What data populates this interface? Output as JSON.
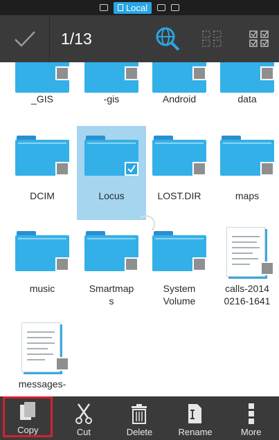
{
  "location_bar": {
    "label": "Local"
  },
  "header": {
    "selection_count": "1/13"
  },
  "grid": {
    "items": [
      {
        "name": "_GIS",
        "type": "folder",
        "selected": false
      },
      {
        "name": "-gis",
        "type": "folder",
        "selected": false
      },
      {
        "name": "Android",
        "type": "folder",
        "selected": false
      },
      {
        "name": "data",
        "type": "folder",
        "selected": false
      },
      {
        "name": "DCIM",
        "type": "folder",
        "selected": false
      },
      {
        "name": "Locus",
        "type": "folder",
        "selected": true
      },
      {
        "name": "LOST.DIR",
        "type": "folder",
        "selected": false
      },
      {
        "name": "maps",
        "type": "folder",
        "selected": false
      },
      {
        "name": "music",
        "type": "folder",
        "selected": false
      },
      {
        "name": "Smartmaps",
        "type": "folder",
        "selected": false
      },
      {
        "name": "System Volume",
        "type": "folder",
        "selected": false
      },
      {
        "name": "calls-20140216-1641",
        "type": "file",
        "selected": false
      },
      {
        "name": "messages-",
        "type": "file",
        "selected": false
      }
    ],
    "labels": {
      "r1c1": "_GIS",
      "r1c2": "-gis",
      "r1c3": "Android",
      "r1c4": "data",
      "r2c1": "DCIM",
      "r2c2": "Locus",
      "r2c3": "LOST.DIR",
      "r2c4": "maps",
      "r3c1": "music",
      "r3c2a": "Smartmap",
      "r3c2b": "s",
      "r3c3a": "System",
      "r3c3b": "Volume",
      "r3c4a": "calls-2014",
      "r3c4b": "0216-1641",
      "r4c1": "messages-"
    }
  },
  "actions": {
    "copy": "Copy",
    "cut": "Cut",
    "delete": "Delete",
    "rename": "Rename",
    "more": "More"
  },
  "colors": {
    "accent": "#2aa6e2",
    "folder": "#34b0e8",
    "selected_tile": "#a6d5ef",
    "toolbar": "#3a3a3a",
    "highlight_outline": "#d6202e"
  },
  "icons": {
    "header": [
      "checkmark-icon",
      "network-search-icon",
      "deselect-all-icon",
      "select-all-icon"
    ],
    "actions": [
      "copy-icon",
      "scissors-icon",
      "trash-icon",
      "rename-icon",
      "more-vertical-icon"
    ]
  }
}
